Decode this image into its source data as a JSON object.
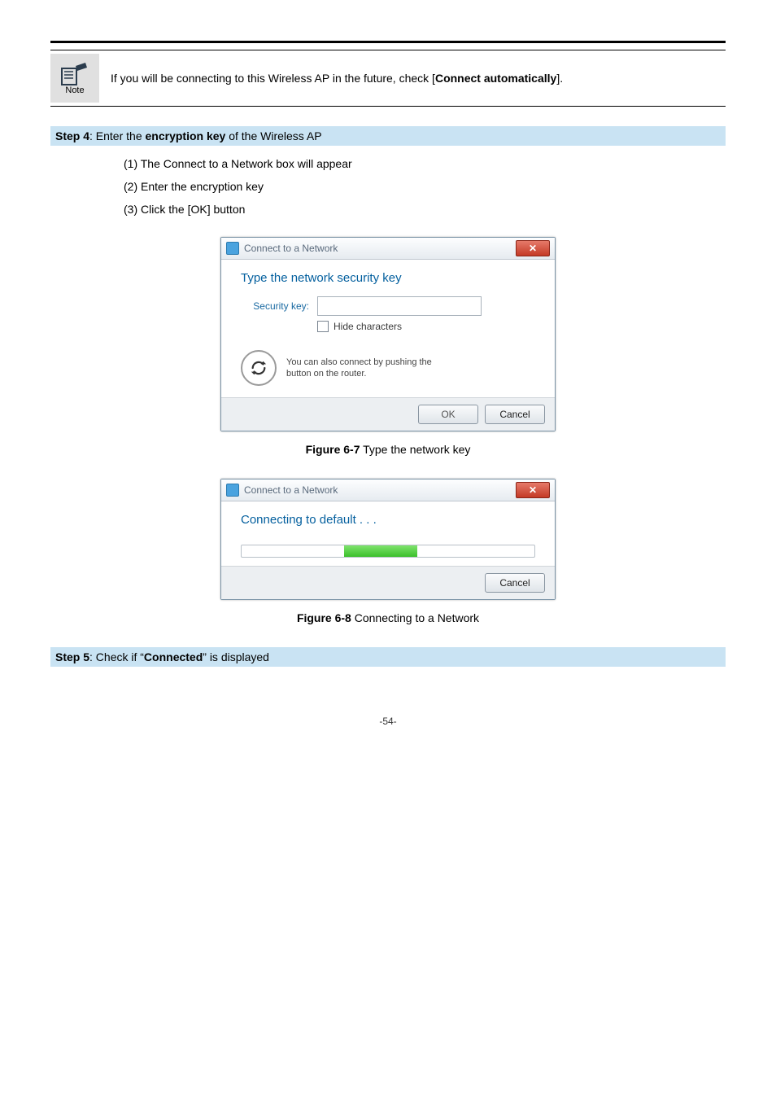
{
  "note": {
    "badge_label": "Note",
    "text_prefix": "If you will be connecting to this Wireless AP in the future, check [",
    "text_strong": "Connect automatically",
    "text_suffix": "]."
  },
  "step4": {
    "label": "Step 4",
    "desc_before": ": Enter the ",
    "desc_strong": "encryption key",
    "desc_after": " of the Wireless AP",
    "items": [
      "(1)  The Connect to a Network box will appear",
      "(2)  Enter the encryption key",
      "(3)  Click the [OK] button"
    ]
  },
  "dialog1": {
    "title": "Connect to a Network",
    "heading": "Type the network security key",
    "sec_label": "Security key:",
    "hide_label": "Hide characters",
    "wps_line1": "You can also connect by pushing the",
    "wps_line2": "button on the router.",
    "ok": "OK",
    "cancel": "Cancel"
  },
  "figure1": {
    "strong": "Figure 6-7",
    "rest": " Type the network key"
  },
  "dialog2": {
    "title": "Connect to a Network",
    "progress_text": "Connecting to default . . .",
    "cancel": "Cancel"
  },
  "figure2": {
    "strong": "Figure 6-8",
    "rest": " Connecting to a Network"
  },
  "step5": {
    "label": "Step 5",
    "desc_before": ": Check if “",
    "desc_strong": "Connected",
    "desc_after": "” is displayed"
  },
  "page_number": "-54-"
}
